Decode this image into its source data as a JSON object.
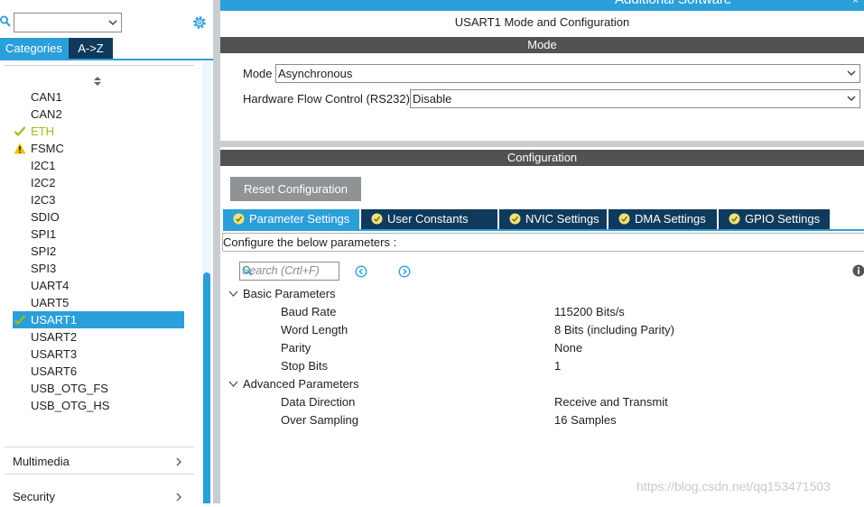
{
  "top": {
    "title": "Additional Software",
    "close": "×"
  },
  "left": {
    "tabs": [
      "Categories",
      "A->Z"
    ],
    "items": [
      {
        "label": "CAN1",
        "state": "none"
      },
      {
        "label": "CAN2",
        "state": "none"
      },
      {
        "label": "ETH",
        "state": "ok"
      },
      {
        "label": "FSMC",
        "state": "warn"
      },
      {
        "label": "I2C1",
        "state": "none"
      },
      {
        "label": "I2C2",
        "state": "none"
      },
      {
        "label": "I2C3",
        "state": "none"
      },
      {
        "label": "SDIO",
        "state": "none"
      },
      {
        "label": "SPI1",
        "state": "none"
      },
      {
        "label": "SPI2",
        "state": "none"
      },
      {
        "label": "SPI3",
        "state": "none"
      },
      {
        "label": "UART4",
        "state": "none"
      },
      {
        "label": "UART5",
        "state": "none"
      },
      {
        "label": "USART1",
        "state": "selected"
      },
      {
        "label": "USART2",
        "state": "none"
      },
      {
        "label": "USART3",
        "state": "none"
      },
      {
        "label": "USART6",
        "state": "none"
      },
      {
        "label": "USB_OTG_FS",
        "state": "none"
      },
      {
        "label": "USB_OTG_HS",
        "state": "none"
      }
    ],
    "groups": [
      "Multimedia",
      "Security"
    ]
  },
  "main": {
    "title": "USART1 Mode and Configuration",
    "mode_bar": "Mode",
    "mode_label": "Mode",
    "mode_value": "Asynchronous",
    "hwflow_label": "Hardware Flow Control (RS232)",
    "hwflow_value": "Disable",
    "config_bar": "Configuration",
    "reset_label": "Reset Configuration",
    "tabs": [
      "Parameter Settings",
      "User Constants",
      "NVIC Settings",
      "DMA Settings",
      "GPIO Settings"
    ],
    "configure_text": "Configure the below parameters :",
    "search_placeholder": "Search (Crtl+F)",
    "basic_group": "Basic Parameters",
    "basic": [
      {
        "name": "Baud Rate",
        "value": "115200 Bits/s"
      },
      {
        "name": "Word Length",
        "value": "8 Bits (including Parity)"
      },
      {
        "name": "Parity",
        "value": "None"
      },
      {
        "name": "Stop Bits",
        "value": "1"
      }
    ],
    "advanced_group": "Advanced Parameters",
    "advanced": [
      {
        "name": "Data Direction",
        "value": "Receive and Transmit"
      },
      {
        "name": "Over Sampling",
        "value": "16 Samples"
      }
    ]
  },
  "watermark": "https://blog.csdn.net/qq153471503",
  "colors": {
    "accent": "#2b9fd9",
    "dark_tab": "#0f3a5c",
    "bar": "#525252",
    "ok": "#a7b81f",
    "warn": "#f0c400"
  }
}
